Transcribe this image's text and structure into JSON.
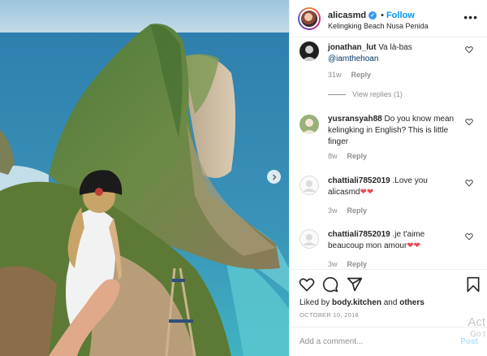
{
  "post": {
    "username": "alicasmd",
    "verified_icon": "verified-check-icon",
    "separator": "•",
    "follow_label": "Follow",
    "location": "Kelingking Beach Nusa Penida",
    "more_icon": "more-options-icon"
  },
  "photo": {
    "description_icon": "photo",
    "next_icon": "chevron-right-icon"
  },
  "comments": [
    {
      "username": "jonathan_lut",
      "text": "Va là-bas",
      "mention": "@iamthehoan",
      "time": "31w",
      "reply_label": "Reply",
      "view_replies": "View replies (1)"
    },
    {
      "username": "yusransyah88",
      "text": "Do you know mean kelingking in English? This is little finger",
      "time": "8w",
      "reply_label": "Reply"
    },
    {
      "username": "chattiali7852019",
      "text": ".Love you alicasmd",
      "hearts": "❤❤",
      "time": "3w",
      "reply_label": "Reply"
    },
    {
      "username": "chattiali7852019",
      "text": ".je t'aime beaucoup mon amour",
      "hearts": "❤❤",
      "time": "3w",
      "reply_label": "Reply"
    }
  ],
  "actions": {
    "like_icon": "heart-icon",
    "comment_icon": "comment-icon",
    "share_icon": "share-icon",
    "save_icon": "bookmark-icon"
  },
  "likes": {
    "prefix": "Liked by",
    "user": "body.kitchen",
    "and": "and",
    "others": "others"
  },
  "date": "OCTOBER 10, 2018",
  "add_comment": {
    "placeholder": "Add a comment...",
    "post_label": "Post"
  },
  "watermark": {
    "line1": "Act",
    "line2": "Go t"
  },
  "colors": {
    "accent": "#0095f6",
    "heart_red": "#ed4956",
    "muted": "#8e8e8e"
  }
}
